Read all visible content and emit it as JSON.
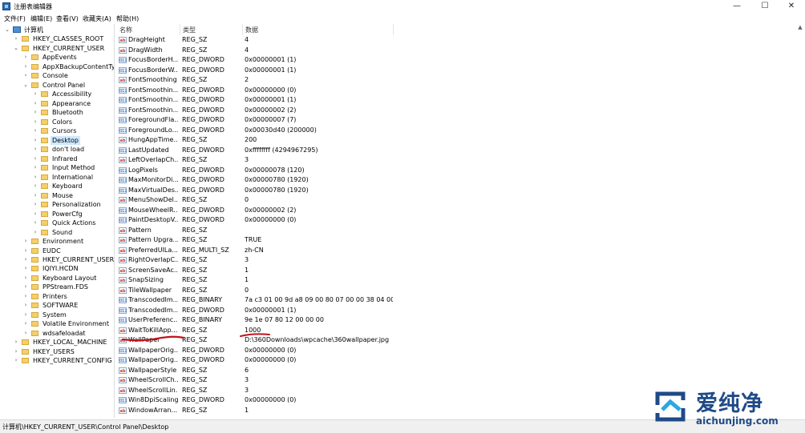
{
  "window": {
    "title": "注册表编辑器",
    "minimize_glyph": "—",
    "maximize_glyph": "☐",
    "close_glyph": "✕"
  },
  "menu": [
    "文件(F)",
    "编辑(E)",
    "查看(V)",
    "收藏夹(A)",
    "帮助(H)"
  ],
  "tree": {
    "root": "计算机",
    "hkcr": "HKEY_CLASSES_ROOT",
    "hkcu": "HKEY_CURRENT_USER",
    "hkcu_children": [
      "AppEvents",
      "AppXBackupContentTy",
      "Console",
      "Control Panel"
    ],
    "control_panel_children": [
      "Accessibility",
      "Appearance",
      "Bluetooth",
      "Colors",
      "Cursors",
      "Desktop",
      "don't load",
      "Infrared",
      "Input Method",
      "International",
      "Keyboard",
      "Mouse",
      "Personalization",
      "PowerCfg",
      "Quick Actions",
      "Sound"
    ],
    "hkcu_children_after": [
      "Environment",
      "EUDC",
      "HKEY_CURRENT_USER",
      "IQIYI.HCDN",
      "Keyboard Layout",
      "PPStream.FDS",
      "Printers",
      "SOFTWARE",
      "System",
      "Volatile Environment",
      "wdsafeloadat"
    ],
    "hives_after": [
      "HKEY_LOCAL_MACHINE",
      "HKEY_USERS",
      "HKEY_CURRENT_CONFIG"
    ],
    "selected": "Desktop"
  },
  "list": {
    "columns": [
      "名称",
      "类型",
      "数据"
    ],
    "rows": [
      {
        "icon": "string-value-icon",
        "name": "DragHeight",
        "type": "REG_SZ",
        "data": "4"
      },
      {
        "icon": "string-value-icon",
        "name": "DragWidth",
        "type": "REG_SZ",
        "data": "4"
      },
      {
        "icon": "binary-value-icon",
        "name": "FocusBorderH...",
        "type": "REG_DWORD",
        "data": "0x00000001 (1)"
      },
      {
        "icon": "binary-value-icon",
        "name": "FocusBorderW...",
        "type": "REG_DWORD",
        "data": "0x00000001 (1)"
      },
      {
        "icon": "string-value-icon",
        "name": "FontSmoothing",
        "type": "REG_SZ",
        "data": "2"
      },
      {
        "icon": "binary-value-icon",
        "name": "FontSmoothin...",
        "type": "REG_DWORD",
        "data": "0x00000000 (0)"
      },
      {
        "icon": "binary-value-icon",
        "name": "FontSmoothin...",
        "type": "REG_DWORD",
        "data": "0x00000001 (1)"
      },
      {
        "icon": "binary-value-icon",
        "name": "FontSmoothin...",
        "type": "REG_DWORD",
        "data": "0x00000002 (2)"
      },
      {
        "icon": "binary-value-icon",
        "name": "ForegroundFla...",
        "type": "REG_DWORD",
        "data": "0x00000007 (7)"
      },
      {
        "icon": "binary-value-icon",
        "name": "ForegroundLo...",
        "type": "REG_DWORD",
        "data": "0x00030d40 (200000)"
      },
      {
        "icon": "string-value-icon",
        "name": "HungAppTime...",
        "type": "REG_SZ",
        "data": "200"
      },
      {
        "icon": "binary-value-icon",
        "name": "LastUpdated",
        "type": "REG_DWORD",
        "data": "0xffffffff (4294967295)"
      },
      {
        "icon": "string-value-icon",
        "name": "LeftOverlapCh...",
        "type": "REG_SZ",
        "data": "3"
      },
      {
        "icon": "binary-value-icon",
        "name": "LogPixels",
        "type": "REG_DWORD",
        "data": "0x00000078 (120)"
      },
      {
        "icon": "binary-value-icon",
        "name": "MaxMonitorDi...",
        "type": "REG_DWORD",
        "data": "0x00000780 (1920)"
      },
      {
        "icon": "binary-value-icon",
        "name": "MaxVirtualDes...",
        "type": "REG_DWORD",
        "data": "0x00000780 (1920)"
      },
      {
        "icon": "string-value-icon",
        "name": "MenuShowDel...",
        "type": "REG_SZ",
        "data": "0"
      },
      {
        "icon": "binary-value-icon",
        "name": "MouseWheelR...",
        "type": "REG_DWORD",
        "data": "0x00000002 (2)"
      },
      {
        "icon": "binary-value-icon",
        "name": "PaintDesktopV...",
        "type": "REG_DWORD",
        "data": "0x00000000 (0)"
      },
      {
        "icon": "string-value-icon",
        "name": "Pattern",
        "type": "REG_SZ",
        "data": ""
      },
      {
        "icon": "string-value-icon",
        "name": "Pattern Upgra...",
        "type": "REG_SZ",
        "data": "TRUE"
      },
      {
        "icon": "string-value-icon",
        "name": "PreferredUILa...",
        "type": "REG_MULTI_SZ",
        "data": "zh-CN"
      },
      {
        "icon": "string-value-icon",
        "name": "RightOverlapC...",
        "type": "REG_SZ",
        "data": "3"
      },
      {
        "icon": "string-value-icon",
        "name": "ScreenSaveAc...",
        "type": "REG_SZ",
        "data": "1"
      },
      {
        "icon": "string-value-icon",
        "name": "SnapSizing",
        "type": "REG_SZ",
        "data": "1"
      },
      {
        "icon": "string-value-icon",
        "name": "TileWallpaper",
        "type": "REG_SZ",
        "data": "0"
      },
      {
        "icon": "binary-value-icon",
        "name": "TranscodedIm...",
        "type": "REG_BINARY",
        "data": "7a c3 01 00 9d a8 09 00 80 07 00 00 38 04 00 ..."
      },
      {
        "icon": "binary-value-icon",
        "name": "TranscodedIm...",
        "type": "REG_DWORD",
        "data": "0x00000001 (1)"
      },
      {
        "icon": "binary-value-icon",
        "name": "UserPreferenc...",
        "type": "REG_BINARY",
        "data": "9e 1e 07 80 12 00 00 00"
      },
      {
        "icon": "string-value-icon",
        "name": "WaitToKillApp...",
        "type": "REG_SZ",
        "data": "1000"
      },
      {
        "icon": "string-value-icon",
        "name": "WallPaper",
        "type": "REG_SZ",
        "data": "D:\\360Downloads\\wpcache\\360wallpaper.jpg"
      },
      {
        "icon": "binary-value-icon",
        "name": "WallpaperOrig...",
        "type": "REG_DWORD",
        "data": "0x00000000 (0)"
      },
      {
        "icon": "binary-value-icon",
        "name": "WallpaperOrig...",
        "type": "REG_DWORD",
        "data": "0x00000000 (0)"
      },
      {
        "icon": "string-value-icon",
        "name": "WallpaperStyle",
        "type": "REG_SZ",
        "data": "6"
      },
      {
        "icon": "string-value-icon",
        "name": "WheelScrollCh...",
        "type": "REG_SZ",
        "data": "3"
      },
      {
        "icon": "string-value-icon",
        "name": "WheelScrollLin...",
        "type": "REG_SZ",
        "data": "3"
      },
      {
        "icon": "binary-value-icon",
        "name": "Win8DpiScaling",
        "type": "REG_DWORD",
        "data": "0x00000000 (0)"
      },
      {
        "icon": "string-value-icon",
        "name": "WindowArran...",
        "type": "REG_SZ",
        "data": "1"
      }
    ]
  },
  "status": "计算机\\HKEY_CURRENT_USER\\Control Panel\\Desktop",
  "watermark": {
    "text": "爱纯净",
    "url": "aichunjing.com"
  },
  "colors": {
    "selection": "#cce8ff",
    "annotation": "#c0141c",
    "watermark": "#1f4a87"
  }
}
